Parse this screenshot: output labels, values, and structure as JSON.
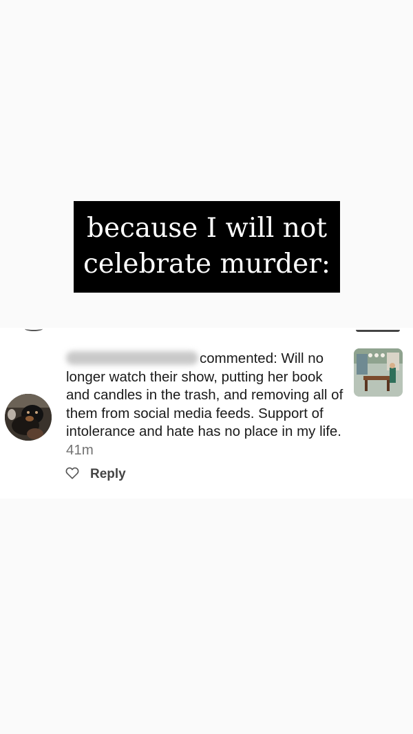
{
  "caption": {
    "line1": "because I will not",
    "line2": "celebrate murder:"
  },
  "comment": {
    "username": "",
    "verb_and_text": "commented: Will no longer watch their show, putting her book and candles in the trash, and removing all of them from social media feeds. Support of intolerance and hate has no place in my life.",
    "time": "41m",
    "reply_label": "Reply"
  },
  "icons": {
    "like": "heart-outline-icon"
  },
  "colors": {
    "background": "#fafafa",
    "caption_bg": "#000000",
    "caption_text": "#ffffff",
    "timestamp": "#737373"
  }
}
